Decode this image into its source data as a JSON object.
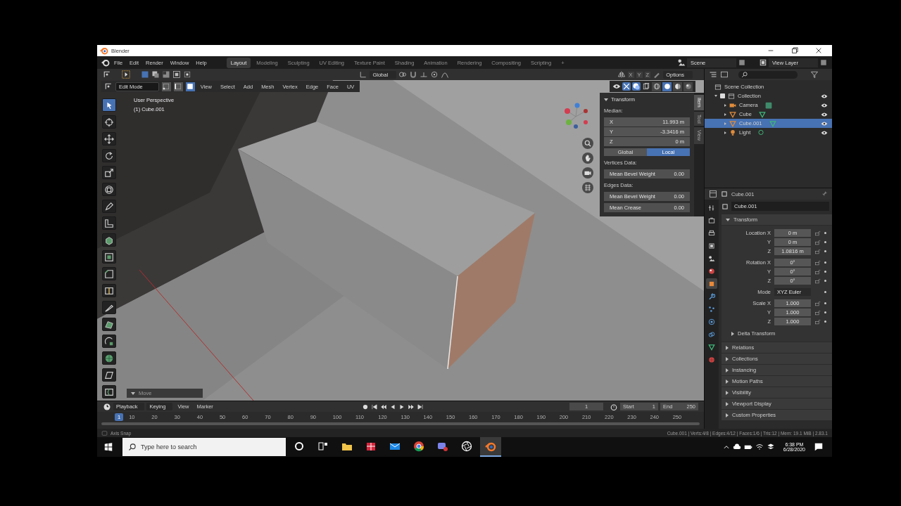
{
  "window": {
    "title": "Blender"
  },
  "menu": [
    "File",
    "Edit",
    "Render",
    "Window",
    "Help"
  ],
  "workspaces": [
    {
      "label": "Layout",
      "selected": true
    },
    {
      "label": "Modeling",
      "selected": false
    },
    {
      "label": "Sculpting",
      "selected": false
    },
    {
      "label": "UV Editing",
      "selected": false
    },
    {
      "label": "Texture Paint",
      "selected": false
    },
    {
      "label": "Shading",
      "selected": false
    },
    {
      "label": "Animation",
      "selected": false
    },
    {
      "label": "Rendering",
      "selected": false
    },
    {
      "label": "Compositing",
      "selected": false
    },
    {
      "label": "Scripting",
      "selected": false
    }
  ],
  "add_workspace": "+",
  "scene": "Scene",
  "view_layer": "View Layer",
  "tool_header": {
    "orientation": "Global",
    "axes": [
      "X",
      "Y",
      "Z"
    ],
    "options": "Options"
  },
  "mode_header": {
    "mode": "Edit Mode",
    "select_modes": [
      {
        "kind": "vertex",
        "selected": false
      },
      {
        "kind": "edge",
        "selected": false
      },
      {
        "kind": "face",
        "selected": true
      }
    ],
    "menus": [
      "View",
      "Select",
      "Add",
      "Mesh",
      "Vertex",
      "Edge",
      "Face",
      "UV"
    ]
  },
  "viewport": {
    "perspective": "User Perspective",
    "object": "(1) Cube.001",
    "last_operator": "Move",
    "tools": [
      {
        "kind": "select",
        "selected": true
      },
      {
        "kind": "cursor",
        "selected": false
      },
      {
        "kind": "move",
        "selected": false
      },
      {
        "kind": "rotate",
        "selected": false
      },
      {
        "kind": "scale",
        "selected": false
      },
      {
        "kind": "transform",
        "selected": false
      },
      {
        "kind": "annotate",
        "selected": false
      },
      {
        "kind": "measure",
        "selected": false
      },
      {
        "kind": "extrude",
        "selected": false
      },
      {
        "kind": "inset",
        "selected": false
      },
      {
        "kind": "bevel",
        "selected": false
      },
      {
        "kind": "loop_cut",
        "selected": false
      },
      {
        "kind": "knife",
        "selected": false
      },
      {
        "kind": "poly_build",
        "selected": false
      },
      {
        "kind": "spin",
        "selected": false
      },
      {
        "kind": "smooth",
        "selected": false
      },
      {
        "kind": "shear",
        "selected": false
      },
      {
        "kind": "rip",
        "selected": false
      }
    ],
    "shading": [
      {
        "kind": "wireframe",
        "selected": false
      },
      {
        "kind": "solid",
        "selected": true
      },
      {
        "kind": "material",
        "selected": false
      },
      {
        "kind": "rendered",
        "selected": false
      }
    ]
  },
  "sidebar": {
    "tabs": [
      {
        "label": "Item",
        "selected": true
      },
      {
        "label": "Tool",
        "selected": false
      },
      {
        "label": "View",
        "selected": false
      }
    ],
    "title": "Transform",
    "median": "Median:",
    "fields": [
      {
        "label": "X",
        "value": "11.993 m"
      },
      {
        "label": "Y",
        "value": "-3.3416 m"
      },
      {
        "label": "Z",
        "value": "0 m"
      }
    ],
    "space": [
      {
        "label": "Global",
        "selected": false
      },
      {
        "label": "Local",
        "selected": true
      }
    ],
    "sections": [
      {
        "title": "Vertices Data:",
        "fields": [
          {
            "label": "Mean Bevel Weight",
            "value": "0.00"
          }
        ]
      },
      {
        "title": "Edges Data:",
        "fields": [
          {
            "label": "Mean Bevel Weight",
            "value": "0.00"
          },
          {
            "label": "Mean Crease",
            "value": "0.00"
          }
        ]
      }
    ]
  },
  "outliner": {
    "root": "Scene Collection",
    "items": [
      {
        "name": "Collection",
        "kind": "collection",
        "checked": true,
        "expanded": true,
        "selected": false,
        "children": [
          {
            "name": "Camera",
            "kind": "camera",
            "expanded": false,
            "selected": false
          },
          {
            "name": "Cube",
            "kind": "mesh",
            "expanded": false,
            "selected": false
          },
          {
            "name": "Cube.001",
            "kind": "mesh",
            "expanded": false,
            "selected": true
          },
          {
            "name": "Light",
            "kind": "light",
            "expanded": false,
            "selected": false
          }
        ]
      }
    ]
  },
  "properties": {
    "object": "Cube.001",
    "name": "Cube.001",
    "tabs": [
      {
        "kind": "tool",
        "selected": false
      },
      {
        "kind": "render",
        "selected": false
      },
      {
        "kind": "output",
        "selected": false
      },
      {
        "kind": "view_layer",
        "selected": false
      },
      {
        "kind": "scene",
        "selected": false
      },
      {
        "kind": "world",
        "selected": false
      },
      {
        "kind": "object",
        "selected": true
      },
      {
        "kind": "modifiers",
        "selected": false
      },
      {
        "kind": "particles",
        "selected": false
      },
      {
        "kind": "physics",
        "selected": false
      },
      {
        "kind": "constraints",
        "selected": false
      },
      {
        "kind": "data",
        "selected": false
      },
      {
        "kind": "material",
        "selected": false
      }
    ],
    "transform": {
      "title": "Transform",
      "groups": [
        {
          "fields": [
            {
              "kind": "number",
              "label": "Location X",
              "value": "0 m"
            },
            {
              "kind": "number",
              "label": "Y",
              "value": "0 m"
            },
            {
              "kind": "number",
              "label": "Z",
              "value": "1.0816 m"
            }
          ]
        },
        {
          "fields": [
            {
              "kind": "number",
              "label": "Rotation X",
              "value": "0°"
            },
            {
              "kind": "number",
              "label": "Y",
              "value": "0°"
            },
            {
              "kind": "number",
              "label": "Z",
              "value": "0°"
            }
          ]
        },
        {
          "fields": [
            {
              "kind": "dropdown",
              "label": "Mode",
              "value": "XYZ Euler"
            }
          ]
        },
        {
          "fields": [
            {
              "kind": "number",
              "label": "Scale X",
              "value": "1.000"
            },
            {
              "kind": "number",
              "label": "Y",
              "value": "1.000"
            },
            {
              "kind": "number",
              "label": "Z",
              "value": "1.000"
            }
          ]
        }
      ],
      "subpanel": "Delta Transform"
    },
    "panels": [
      "Relations",
      "Collections",
      "Instancing",
      "Motion Paths",
      "Visibility",
      "Viewport Display",
      "Custom Properties"
    ]
  },
  "timeline": {
    "menus": [
      "Playback",
      "Keying",
      "View",
      "Marker"
    ],
    "frame": "1",
    "start_label": "Start",
    "start": "1",
    "end_label": "End",
    "end": "250",
    "playhead": "1",
    "ruler": [
      "10",
      "20",
      "30",
      "40",
      "50",
      "60",
      "70",
      "80",
      "90",
      "100",
      "110",
      "120",
      "130",
      "140",
      "150",
      "160",
      "170",
      "180",
      "190",
      "200",
      "210",
      "220",
      "230",
      "240",
      "250"
    ]
  },
  "status_bar": {
    "left": "Axis Snap",
    "right": "Cube.001 | Verts:4/8 | Edges:4/12 | Faces:1/6 | Tris:12 | Mem: 19.1 MiB | 2.83.1"
  },
  "taskbar": {
    "search_placeholder": "Type here to search",
    "apps": [
      {
        "kind": "cortana",
        "active": false
      },
      {
        "kind": "task_view",
        "active": false
      },
      {
        "kind": "explorer",
        "active": false
      },
      {
        "kind": "store",
        "active": false
      },
      {
        "kind": "mail",
        "active": false
      },
      {
        "kind": "browser",
        "active": false
      },
      {
        "kind": "chat",
        "active": false
      },
      {
        "kind": "recorder",
        "active": false
      },
      {
        "kind": "blender",
        "active": true
      }
    ],
    "time": "6:38 PM",
    "date": "6/28/2020"
  }
}
